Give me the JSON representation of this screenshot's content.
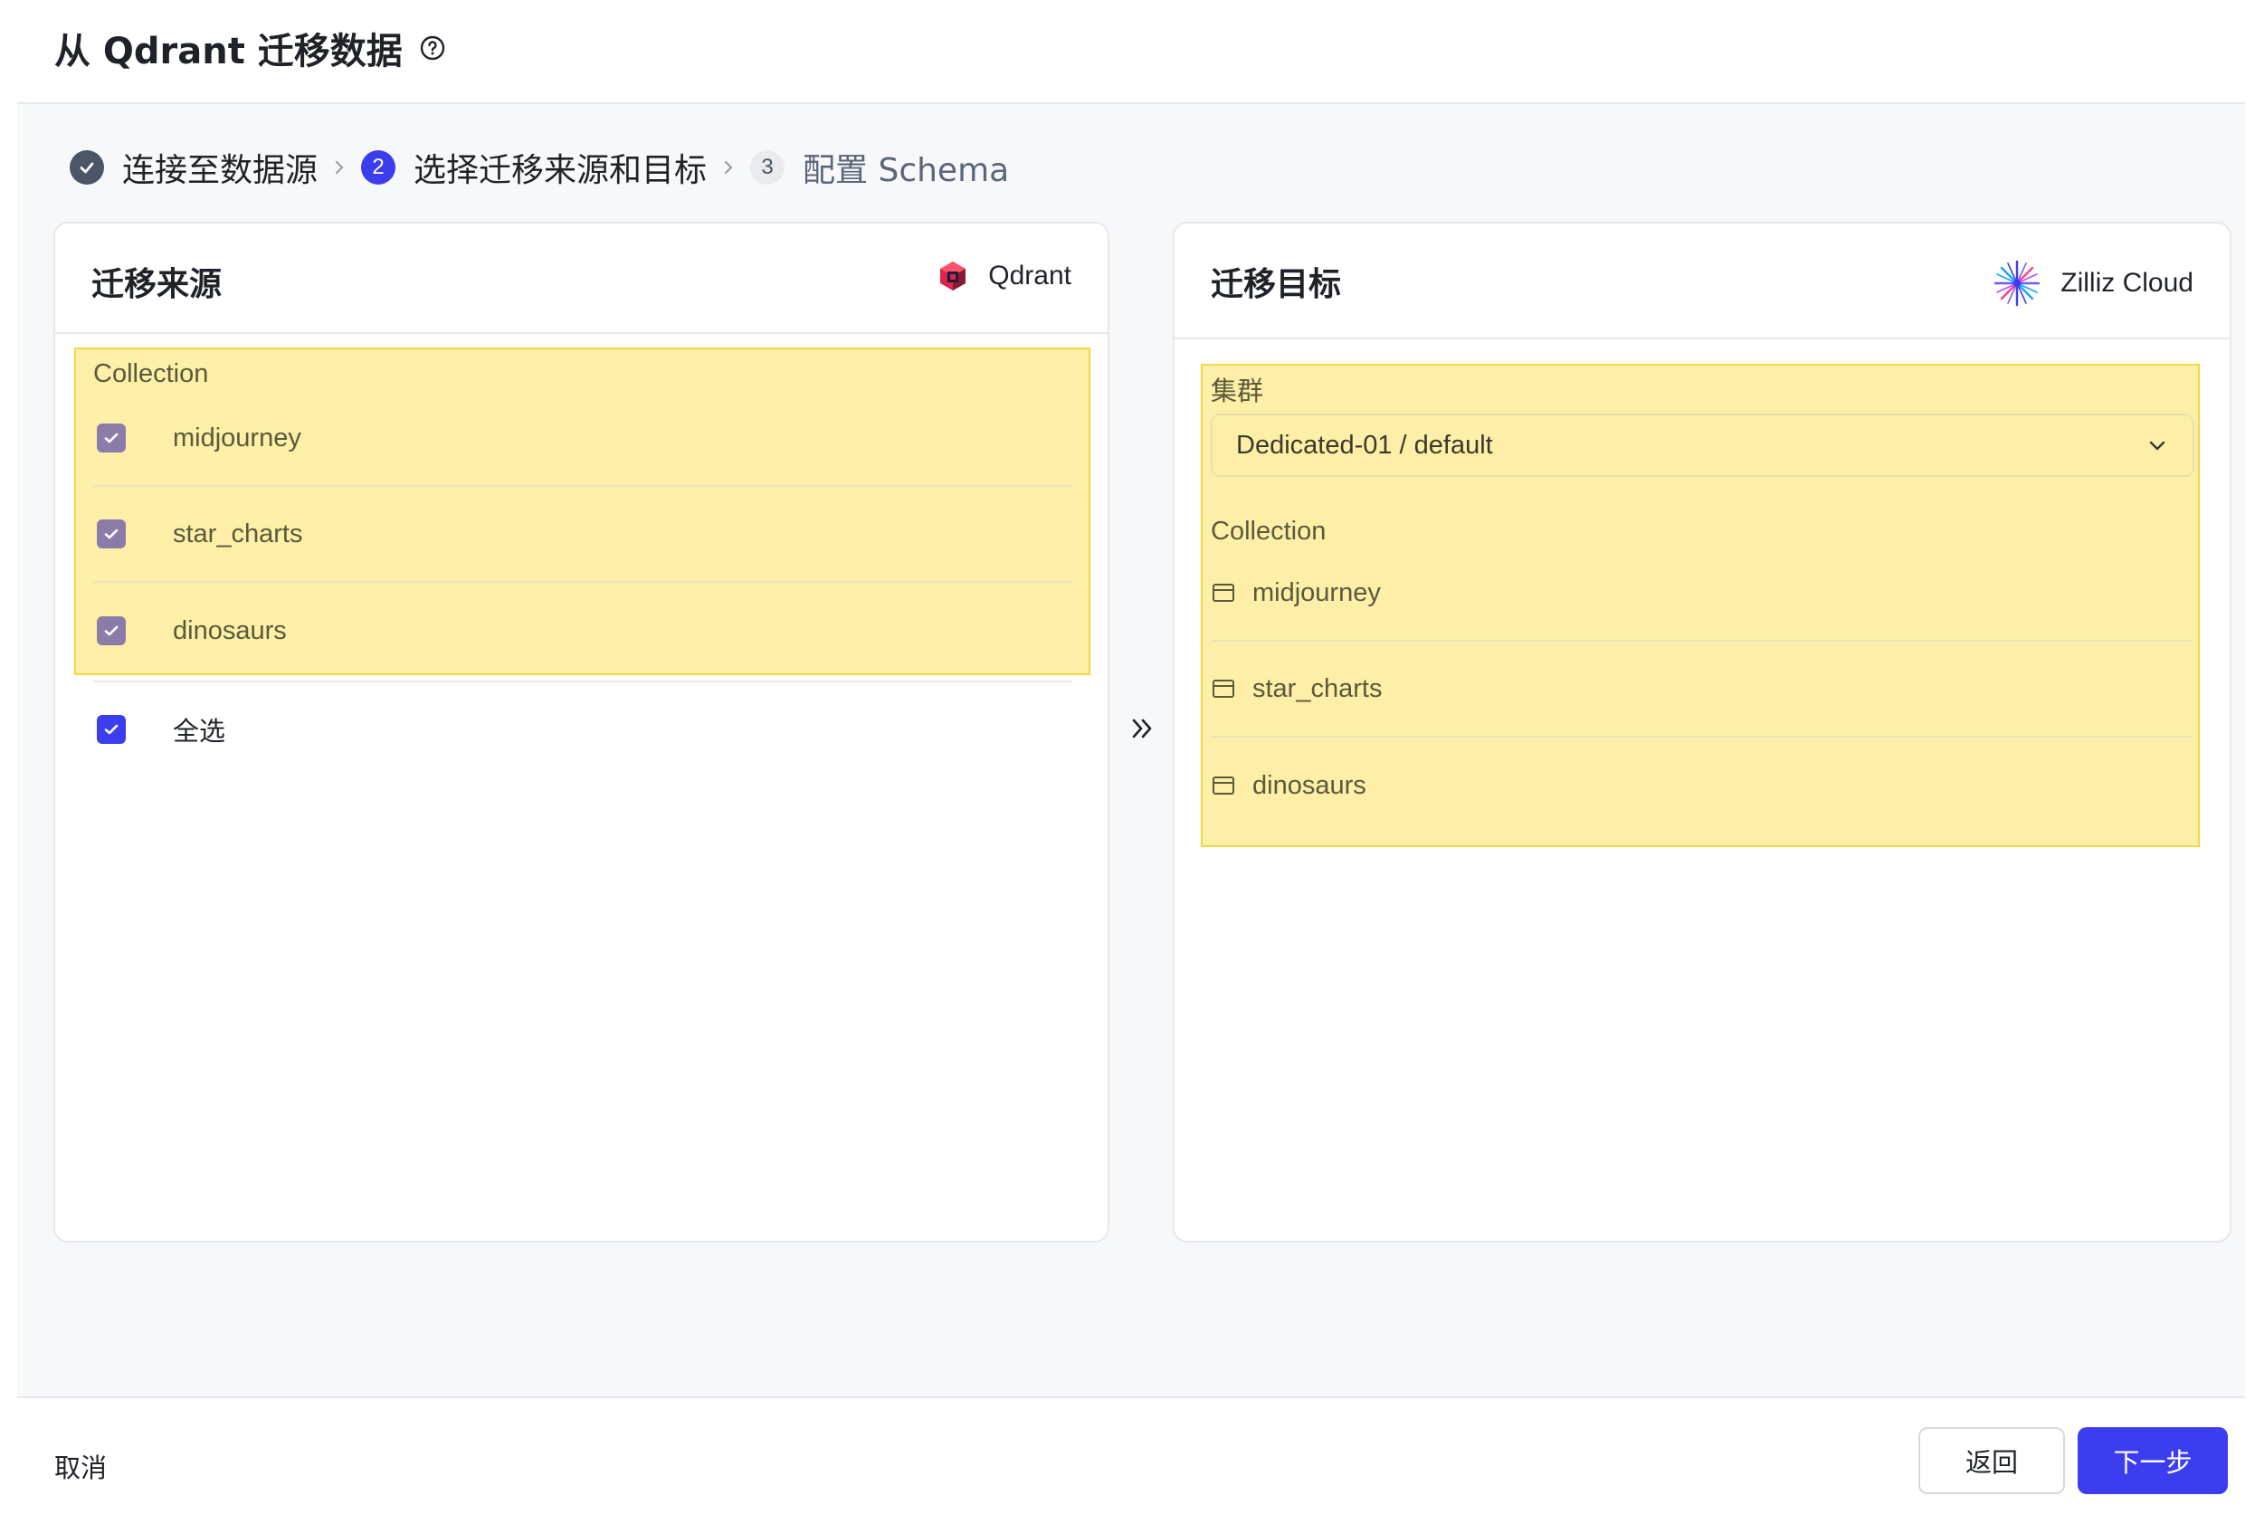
{
  "header": {
    "title": "从 Qdrant 迁移数据",
    "help_icon": "question-circle-icon"
  },
  "steps": [
    {
      "label": "连接至数据源",
      "state": "done",
      "marker": ""
    },
    {
      "label": "选择迁移来源和目标",
      "state": "active",
      "marker": "2"
    },
    {
      "label": "配置 Schema",
      "state": "pending",
      "marker": "3"
    }
  ],
  "source": {
    "title": "迁移来源",
    "brand": "Qdrant",
    "collection_label": "Collection",
    "collections": [
      "midjourney",
      "star_charts",
      "dinosaurs"
    ],
    "select_all_label": "全选"
  },
  "target": {
    "title": "迁移目标",
    "brand": "Zilliz Cloud",
    "cluster_label": "集群",
    "cluster_value": "Dedicated-01 / default",
    "collection_label": "Collection",
    "collections": [
      "midjourney",
      "star_charts",
      "dinosaurs"
    ]
  },
  "footer": {
    "cancel": "取消",
    "back": "返回",
    "next": "下一步"
  },
  "colors": {
    "accent": "#3d3df0",
    "highlight": "#fdefa7",
    "highlight_border": "#f4d742"
  }
}
